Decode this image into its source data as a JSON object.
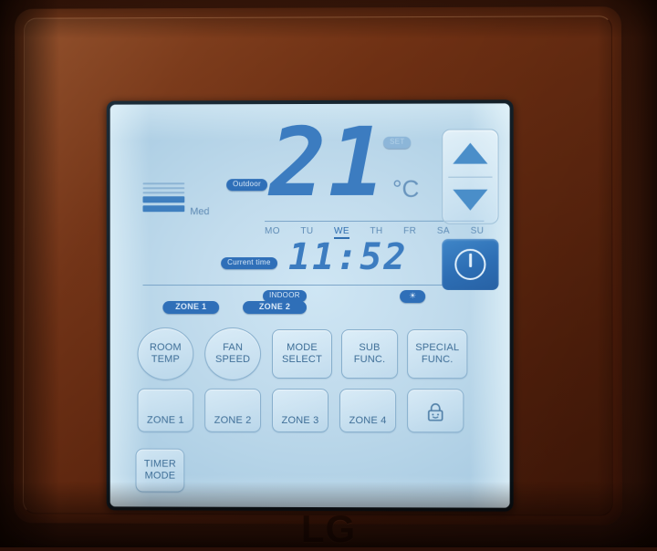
{
  "device": {
    "brand": "LG",
    "type": "wall-mounted air conditioner controller"
  },
  "display": {
    "fan": {
      "level_label": "Med",
      "bars_total": 5,
      "bars_filled": 2
    },
    "temperature": {
      "source_label": "Outdoor",
      "value": "21",
      "unit": "°C",
      "set_badge_label": "SET"
    },
    "weekdays": [
      {
        "label": "MO",
        "active": false
      },
      {
        "label": "TU",
        "active": false
      },
      {
        "label": "WE",
        "active": true
      },
      {
        "label": "TH",
        "active": false
      },
      {
        "label": "FR",
        "active": false
      },
      {
        "label": "SA",
        "active": false
      },
      {
        "label": "SU",
        "active": false
      }
    ],
    "clock": {
      "label": "Current time",
      "value": "11:52"
    },
    "status": {
      "indoor_label": "INDOOR",
      "zone1_label": "ZONE 1",
      "zone2_label": "ZONE 2",
      "mode_icon": "sun-icon",
      "mode_glyph": "☀"
    },
    "function_buttons": [
      {
        "label_line1": "ROOM",
        "label_line2": "TEMP",
        "shape": "round"
      },
      {
        "label_line1": "FAN",
        "label_line2": "SPEED",
        "shape": "round"
      },
      {
        "label_line1": "MODE",
        "label_line2": "SELECT",
        "shape": "rect"
      },
      {
        "label_line1": "SUB",
        "label_line2": "FUNC.",
        "shape": "rect"
      },
      {
        "label_line1": "SPECIAL",
        "label_line2": "FUNC.",
        "shape": "rect"
      }
    ],
    "zone_buttons": [
      {
        "label": "ZONE 1"
      },
      {
        "label": "ZONE 2"
      },
      {
        "label": "ZONE 3"
      },
      {
        "label": "ZONE 4"
      }
    ],
    "lock_button": {
      "icon": "padlock-icon"
    },
    "timer_button": {
      "label_line1": "TIMER",
      "label_line2": "MODE"
    }
  },
  "hard_keys": {
    "up_arrow": "▲",
    "down_arrow": "▼",
    "power_icon": "power-icon"
  },
  "colors": {
    "lcd_accent": "#2f6fb8",
    "lcd_background": "#bcd8ea",
    "segment_blue": "#3c7cc0",
    "faceplate_copper": "#6b2d13",
    "power_button_blue": "#2d6eb4"
  }
}
